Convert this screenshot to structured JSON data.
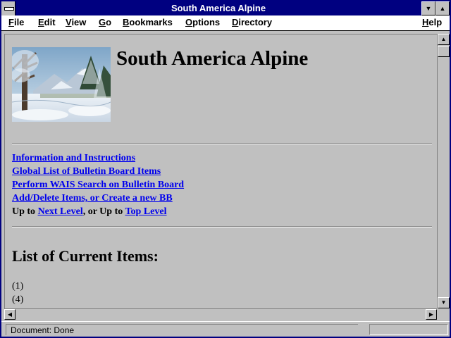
{
  "window": {
    "title": "South America Alpine"
  },
  "menu": {
    "items": [
      {
        "underline": "F",
        "rest": "ile"
      },
      {
        "underline": "E",
        "rest": "dit"
      },
      {
        "underline": "V",
        "rest": "iew"
      },
      {
        "underline": "G",
        "rest": "o"
      },
      {
        "underline": "B",
        "rest": "ookmarks"
      },
      {
        "underline": "O",
        "rest": "ptions"
      },
      {
        "underline": "D",
        "rest": "irectory"
      },
      {
        "underline": "H",
        "rest": "elp"
      }
    ]
  },
  "page": {
    "title": "South America Alpine",
    "links": [
      "Information and Instructions",
      "Global List of Bulletin Board Items",
      "Perform WAIS Search on Bulletin Board",
      "Add/Delete Items, or Create a new BB"
    ],
    "nav": {
      "up_to": "Up to",
      "next_level": "Next Level",
      "or_up_to": ", or Up to",
      "top_level": "Top Level"
    },
    "list_heading": "List of Current Items:",
    "list_items": [
      "(1)",
      "(4)"
    ]
  },
  "status": {
    "text": "Document: Done"
  },
  "colors": {
    "title_bar": "#000080",
    "link": "#0000ee",
    "chrome": "#c0c0c0"
  }
}
